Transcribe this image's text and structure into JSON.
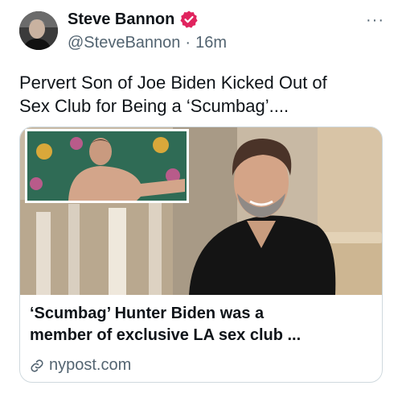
{
  "tweet": {
    "author": {
      "display_name": "Steve Bannon",
      "handle": "@SteveBannon",
      "verified_icon": "verified-badge-icon",
      "badge_color": "#e0245e"
    },
    "separator": "·",
    "timestamp": "16m",
    "more_icon": "more-horizontal-icon",
    "more_label": "···",
    "text_line1": "Pervert Son of Joe Biden Kicked Out of",
    "text_line2": "Sex Club for Being a ‘Scumbag’...."
  },
  "card": {
    "title_line1": "‘Scumbag’ Hunter Biden was a",
    "title_line2": "member of exclusive LA sex club ...",
    "domain": "nypost.com",
    "link_icon": "link-icon"
  },
  "colors": {
    "text_primary": "#0f1419",
    "text_secondary": "#536471",
    "border": "#cfd9de"
  }
}
